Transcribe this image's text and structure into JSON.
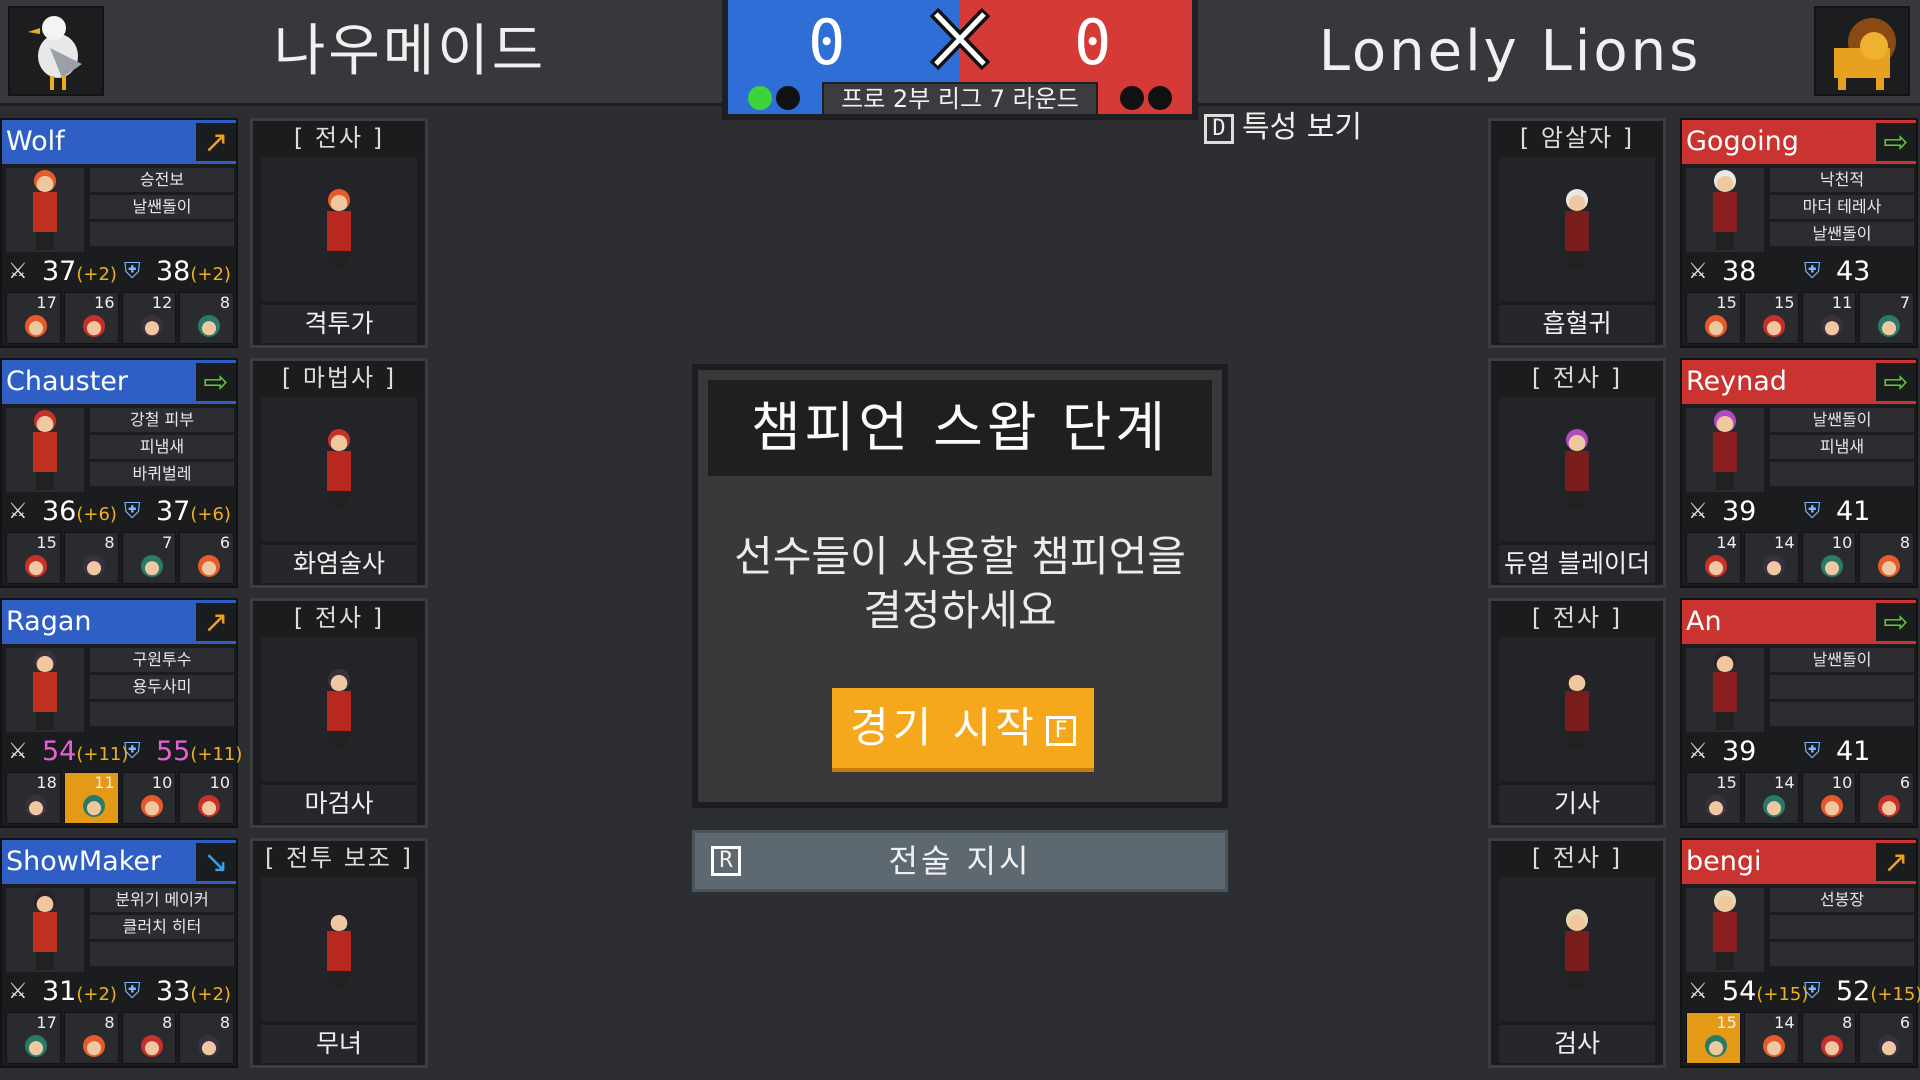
{
  "header": {
    "left_team": "나우메이드",
    "right_team": "Lonely Lions",
    "left_score": "0",
    "right_score": "0",
    "league_round": "프로 2부 리그 7 라운드",
    "trait_toggle_key": "D",
    "trait_toggle_label": "특성 보기",
    "colors": {
      "blue": "#2f6ed6",
      "red": "#d63a36",
      "win_dot": "#3bd43b"
    }
  },
  "left_players": [
    {
      "name": "Wolf",
      "arrow": "↗",
      "arrow_color": "#f0a020",
      "traits": [
        "승전보",
        "날쌘돌이",
        ""
      ],
      "attack": "37",
      "attack_bonus": "(+2)",
      "defense": "38",
      "defense_bonus": "(+2)",
      "stat_color": "#ffffff",
      "mini": [
        {
          "n": "17"
        },
        {
          "n": "16"
        },
        {
          "n": "12"
        },
        {
          "n": "8"
        }
      ]
    },
    {
      "name": "Chauster",
      "arrow": "⇨",
      "arrow_color": "#5fd03a",
      "traits": [
        "강철 피부",
        "피냄새",
        "바퀴벌레"
      ],
      "attack": "36",
      "attack_bonus": "(+6)",
      "defense": "37",
      "defense_bonus": "(+6)",
      "stat_color": "#ffffff",
      "mini": [
        {
          "n": "15"
        },
        {
          "n": "8"
        },
        {
          "n": "7"
        },
        {
          "n": "6"
        }
      ]
    },
    {
      "name": "Ragan",
      "arrow": "↗",
      "arrow_color": "#f0a020",
      "traits": [
        "구원투수",
        "용두사미",
        ""
      ],
      "attack": "54",
      "attack_bonus": "(+11)",
      "defense": "55",
      "defense_bonus": "(+11)",
      "stat_color": "#e860d8",
      "mini": [
        {
          "n": "18"
        },
        {
          "n": "11",
          "hl": true
        },
        {
          "n": "10"
        },
        {
          "n": "10"
        }
      ]
    },
    {
      "name": "ShowMaker",
      "arrow": "↘",
      "arrow_color": "#3aa0e8",
      "traits": [
        "분위기 메이커",
        "클러치 히터",
        ""
      ],
      "attack": "31",
      "attack_bonus": "(+2)",
      "defense": "33",
      "defense_bonus": "(+2)",
      "stat_color": "#ffffff",
      "mini": [
        {
          "n": "17"
        },
        {
          "n": "8"
        },
        {
          "n": "8"
        },
        {
          "n": "8"
        }
      ]
    }
  ],
  "left_roles": [
    {
      "role": "전사",
      "champion": "격투가"
    },
    {
      "role": "마법사",
      "champion": "화염술사"
    },
    {
      "role": "전사",
      "champion": "마검사"
    },
    {
      "role": "전투 보조",
      "champion": "무녀"
    }
  ],
  "right_roles": [
    {
      "role": "암살자",
      "champion": "흡혈귀"
    },
    {
      "role": "전사",
      "champion": "듀얼 블레이더"
    },
    {
      "role": "전사",
      "champion": "기사"
    },
    {
      "role": "전사",
      "champion": "검사"
    }
  ],
  "right_players": [
    {
      "name": "Gogoing",
      "arrow": "⇨",
      "arrow_color": "#5fd03a",
      "traits": [
        "낙천적",
        "마더 테레사",
        "날쌘돌이"
      ],
      "attack": "38",
      "attack_bonus": "",
      "defense": "43",
      "defense_bonus": "",
      "stat_color": "#ffffff",
      "mini": [
        {
          "n": "15"
        },
        {
          "n": "15"
        },
        {
          "n": "11"
        },
        {
          "n": "7"
        }
      ]
    },
    {
      "name": "Reynad",
      "arrow": "⇨",
      "arrow_color": "#5fd03a",
      "traits": [
        "날쌘돌이",
        "피냄새",
        ""
      ],
      "attack": "39",
      "attack_bonus": "",
      "defense": "41",
      "defense_bonus": "",
      "stat_color": "#ffffff",
      "mini": [
        {
          "n": "14"
        },
        {
          "n": "14"
        },
        {
          "n": "10"
        },
        {
          "n": "8"
        }
      ]
    },
    {
      "name": "An",
      "arrow": "⇨",
      "arrow_color": "#5fd03a",
      "traits": [
        "날쌘돌이",
        "",
        ""
      ],
      "attack": "39",
      "attack_bonus": "",
      "defense": "41",
      "defense_bonus": "",
      "stat_color": "#ffffff",
      "mini": [
        {
          "n": "15"
        },
        {
          "n": "14"
        },
        {
          "n": "10"
        },
        {
          "n": "6"
        }
      ]
    },
    {
      "name": "bengi",
      "arrow": "↗",
      "arrow_color": "#f0a020",
      "traits": [
        "선봉장",
        "",
        ""
      ],
      "attack": "54",
      "attack_bonus": "(+15)",
      "defense": "52",
      "defense_bonus": "(+15)",
      "stat_color": "#ffffff",
      "mini": [
        {
          "n": "15",
          "hl": true
        },
        {
          "n": "14"
        },
        {
          "n": "8"
        },
        {
          "n": "6"
        }
      ]
    }
  ],
  "dialog": {
    "title": "챔피언 스왑 단계",
    "message_line1": "선수들이 사용할 챔피언을",
    "message_line2": "결정하세요",
    "start_label": "경기 시작",
    "start_key": "F"
  },
  "tactics": {
    "key": "R",
    "label": "전술 지시"
  },
  "icons": {
    "sword": "sword-icon",
    "shield": "shield-icon",
    "vs": "crossed-swords-icon"
  }
}
